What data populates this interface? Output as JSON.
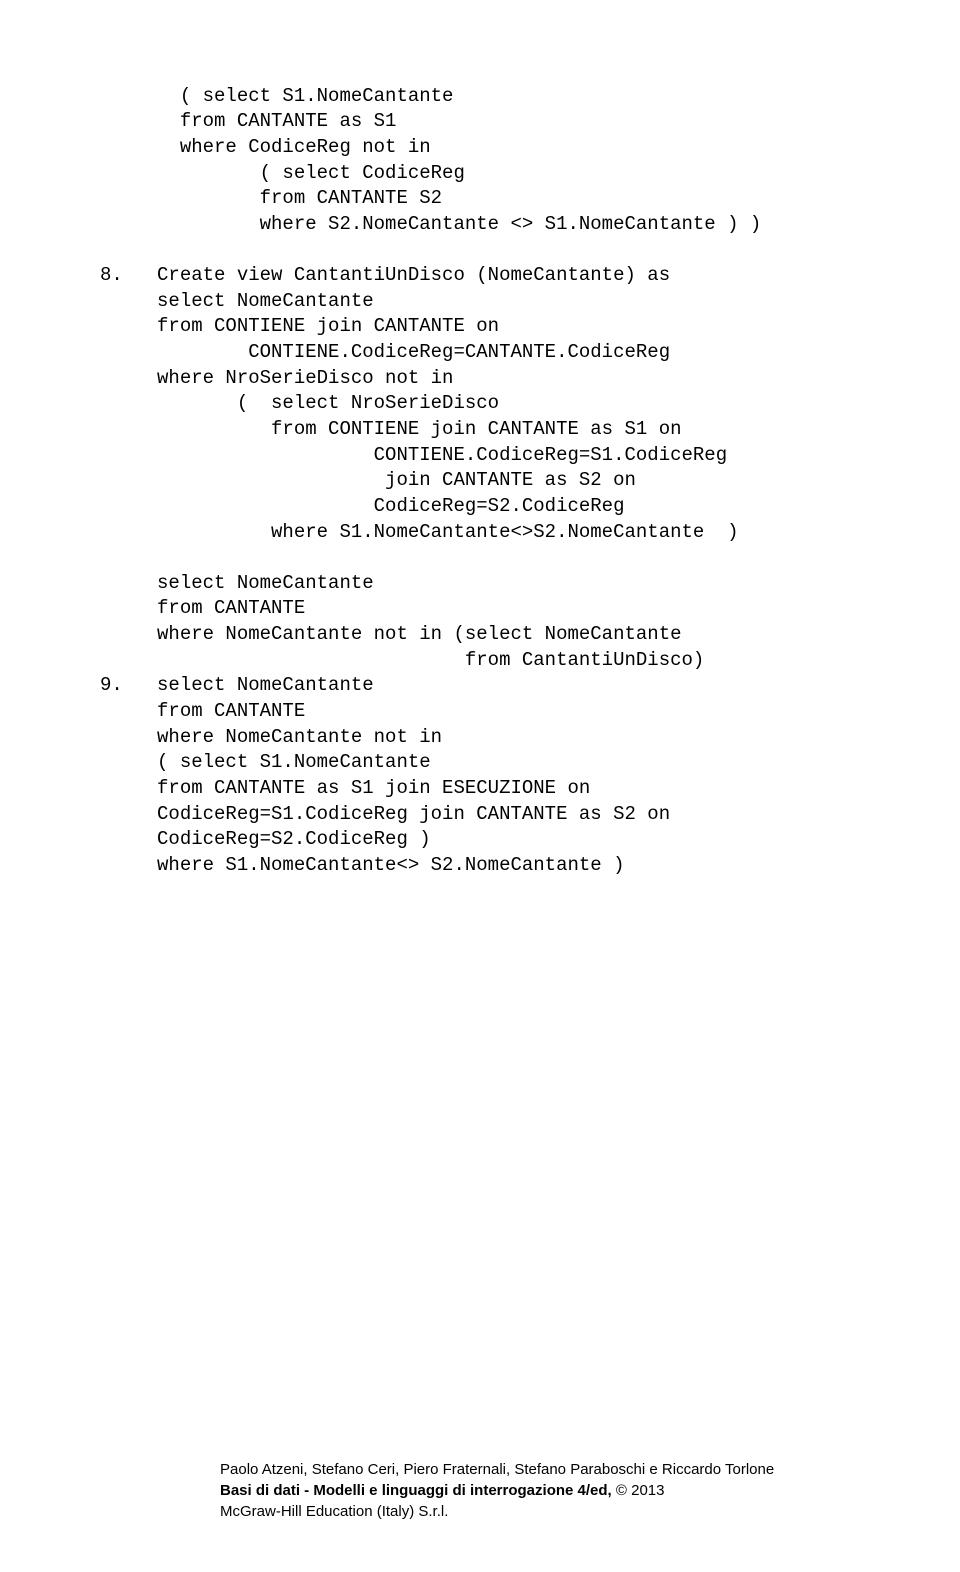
{
  "lines": {
    "l1": "       ( select S1.NomeCantante",
    "l2": "       from CANTANTE as S1",
    "l3": "       where CodiceReg not in",
    "l4": "              ( select CodiceReg",
    "l5": "              from CANTANTE S2",
    "l6": "              where S2.NomeCantante <> S1.NomeCantante ) )",
    "l7": "",
    "l8": "8.   Create view CantantiUnDisco (NomeCantante) as",
    "l9": "     select NomeCantante",
    "l10": "     from CONTIENE join CANTANTE on",
    "l11": "             CONTIENE.CodiceReg=CANTANTE.CodiceReg",
    "l12": "     where NroSerieDisco not in",
    "l13": "            (  select NroSerieDisco",
    "l14": "               from CONTIENE join CANTANTE as S1 on",
    "l15": "                        CONTIENE.CodiceReg=S1.CodiceReg",
    "l16": "                         join CANTANTE as S2 on",
    "l17": "                        CodiceReg=S2.CodiceReg",
    "l18": "               where S1.NomeCantante<>S2.NomeCantante  )",
    "l19": "",
    "l20": "     select NomeCantante",
    "l21": "     from CANTANTE",
    "l22": "     where NomeCantante not in (select NomeCantante",
    "l23": "                                from CantantiUnDisco)",
    "l24": "9.   select NomeCantante",
    "l25": "     from CANTANTE",
    "l26": "     where NomeCantante not in",
    "l27": "     ( select S1.NomeCantante",
    "l28": "     from CANTANTE as S1 join ESECUZIONE on",
    "l29": "     CodiceReg=S1.CodiceReg join CANTANTE as S2 on",
    "l30": "     CodiceReg=S2.CodiceReg )",
    "l31": "     where S1.NomeCantante<> S2.NomeCantante )"
  },
  "footer": {
    "line1": "Paolo Atzeni, Stefano Ceri, Piero Fraternali, Stefano Paraboschi e Riccardo Torlone",
    "line2_bold": "Basi di dati - Modelli e linguaggi di interrogazione 4/ed,",
    "line2_rest": " © 2013",
    "line3": "McGraw-Hill Education (Italy) S.r.l."
  }
}
